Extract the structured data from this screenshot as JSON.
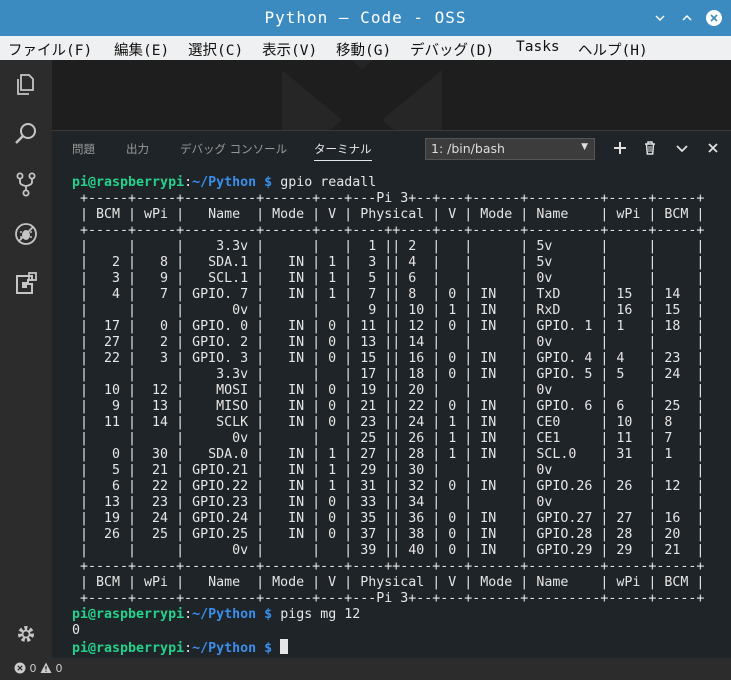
{
  "window": {
    "title": "Python — Code - OSS"
  },
  "menu": [
    "ファイル(F)",
    "編集(E)",
    "選択(C)",
    "表示(V)",
    "移動(G)",
    "デバッグ(D)",
    "Tasks",
    "ヘルプ(H)"
  ],
  "activity_icons": [
    "explorer-icon",
    "search-icon",
    "source-control-icon",
    "debug-icon",
    "extensions-icon"
  ],
  "panel": {
    "tabs": [
      "問題",
      "出力",
      "デバッグ コンソール",
      "ターミナル"
    ],
    "active_tab": "ターミナル",
    "terminal_select": "1: /bin/bash"
  },
  "terminal": {
    "prompt_user": "pi@raspberrypi",
    "prompt_path": "~/Python",
    "prompt_symbol": "$",
    "cmd1": "gpio readall",
    "table_lines": [
      " +-----+-----+---------+------+---+---Pi 3+--+---+------+---------+-----+-----+",
      " | BCM | wPi |   Name  | Mode | V | Physical | V | Mode | Name    | wPi | BCM |",
      " +-----+-----+---------+------+---+----++----+---+------+---------+-----+-----+",
      " |     |     |    3.3v |      |   |  1 || 2  |   |      | 5v      |     |     |",
      " |   2 |   8 |   SDA.1 |   IN | 1 |  3 || 4  |   |      | 5v      |     |     |",
      " |   3 |   9 |   SCL.1 |   IN | 1 |  5 || 6  |   |      | 0v      |     |     |",
      " |   4 |   7 | GPIO. 7 |   IN | 1 |  7 || 8  | 0 | IN   | TxD     | 15  | 14  |",
      " |     |     |      0v |      |   |  9 || 10 | 1 | IN   | RxD     | 16  | 15  |",
      " |  17 |   0 | GPIO. 0 |   IN | 0 | 11 || 12 | 0 | IN   | GPIO. 1 | 1   | 18  |",
      " |  27 |   2 | GPIO. 2 |   IN | 0 | 13 || 14 |   |      | 0v      |     |     |",
      " |  22 |   3 | GPIO. 3 |   IN | 0 | 15 || 16 | 0 | IN   | GPIO. 4 | 4   | 23  |",
      " |     |     |    3.3v |      |   | 17 || 18 | 0 | IN   | GPIO. 5 | 5   | 24  |",
      " |  10 |  12 |    MOSI |   IN | 0 | 19 || 20 |   |      | 0v      |     |     |",
      " |   9 |  13 |    MISO |   IN | 0 | 21 || 22 | 0 | IN   | GPIO. 6 | 6   | 25  |",
      " |  11 |  14 |    SCLK |   IN | 0 | 23 || 24 | 1 | IN   | CE0     | 10  | 8   |",
      " |     |     |      0v |      |   | 25 || 26 | 1 | IN   | CE1     | 11  | 7   |",
      " |   0 |  30 |   SDA.0 |   IN | 1 | 27 || 28 | 1 | IN   | SCL.0   | 31  | 1   |",
      " |   5 |  21 | GPIO.21 |   IN | 1 | 29 || 30 |   |      | 0v      |     |     |",
      " |   6 |  22 | GPIO.22 |   IN | 1 | 31 || 32 | 0 | IN   | GPIO.26 | 26  | 12  |",
      " |  13 |  23 | GPIO.23 |   IN | 0 | 33 || 34 |   |      | 0v      |     |     |",
      " |  19 |  24 | GPIO.24 |   IN | 0 | 35 || 36 | 0 | IN   | GPIO.27 | 27  | 16  |",
      " |  26 |  25 | GPIO.25 |   IN | 0 | 37 || 38 | 0 | IN   | GPIO.28 | 28  | 20  |",
      " |     |     |      0v |      |   | 39 || 40 | 0 | IN   | GPIO.29 | 29  | 21  |",
      " +-----+-----+---------+------+---+----++----+---+------+---------+-----+-----+",
      " | BCM | wPi |   Name  | Mode | V | Physical | V | Mode | Name    | wPi | BCM |",
      " +-----+-----+---------+------+---+---Pi 3+--+---+------+---------+-----+-----+"
    ],
    "cmd2": "pigs mg 12",
    "output2": "0"
  },
  "status": {
    "errors": "0",
    "warnings": "0"
  },
  "colors": {
    "titlebar": "#3b8bc0",
    "prompt_user": "#23d18b",
    "prompt_path": "#3b8eea"
  }
}
